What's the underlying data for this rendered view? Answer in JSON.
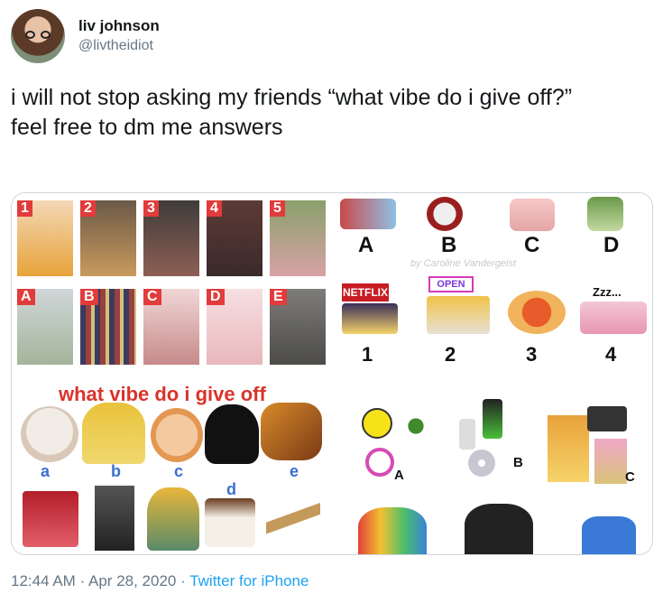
{
  "user": {
    "name": "liv johnson",
    "handle": "@livtheidiot"
  },
  "tweet": {
    "line1": "i will not stop asking my friends “what vibe do i give off?”",
    "line2": "feel free to dm me answers"
  },
  "media": {
    "panel1": {
      "numbers": [
        "1",
        "2",
        "3",
        "4",
        "5"
      ],
      "letters": [
        "A",
        "B",
        "C",
        "D",
        "E"
      ]
    },
    "panel2": {
      "top_letters": [
        "A",
        "B",
        "C",
        "D"
      ],
      "credit": "by Caroline Vandergeist",
      "bottom_numbers": [
        "1",
        "2",
        "3",
        "4"
      ],
      "signs": [
        "NETFLIX",
        "OPEN"
      ],
      "zzz": "Zzz..."
    },
    "panel3": {
      "title": "what vibe do i give off",
      "letters": [
        "a",
        "b",
        "c",
        "d",
        "e"
      ]
    },
    "panel4": {
      "labels": [
        "A",
        "B",
        "C"
      ]
    }
  },
  "footer": {
    "time": "12:44 AM",
    "date": "Apr 28, 2020",
    "source": "Twitter for iPhone"
  },
  "colors": {
    "link": "#1da1f2",
    "muted": "#657786",
    "accent_red": "#e23b3b"
  }
}
